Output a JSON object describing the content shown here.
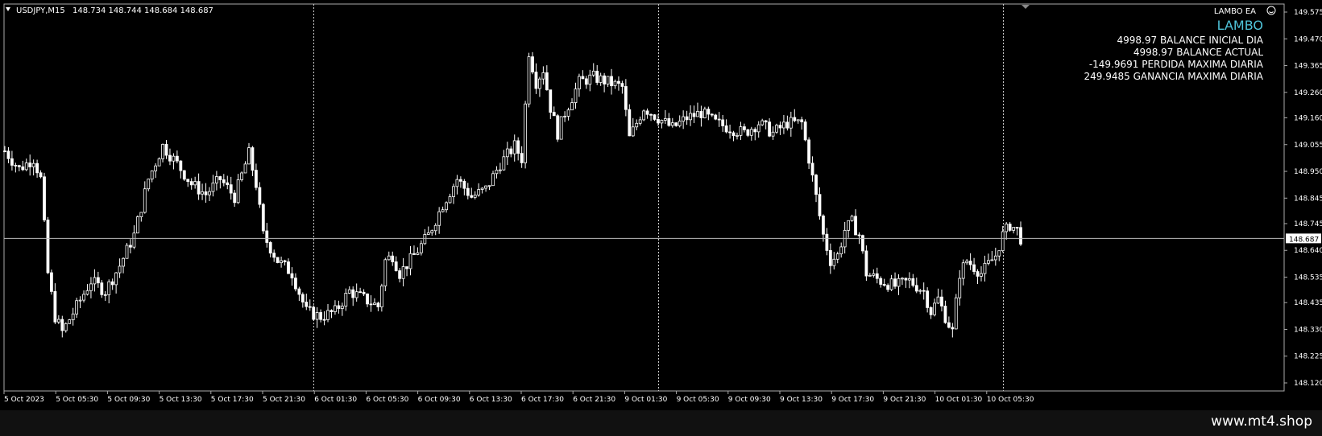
{
  "symbol_header": {
    "symbol": "USDJPY,M15",
    "ohlc": "148.734 148.744 148.684 148.687"
  },
  "ea": {
    "label": "LAMBO EA",
    "title": "LAMBO",
    "lines": [
      "4998.97 BALANCE INICIAL DIA",
      "4998.97 BALANCE ACTUAL",
      "-149.9691 PERDIDA MAXIMA DIARIA",
      "249.9485 GANANCIA MAXIMA DIARIA"
    ]
  },
  "footer": {
    "url": "www.mt4.shop"
  },
  "colors": {
    "background": "#000000",
    "candle": "#ffffff",
    "grid": "#cccccc",
    "ea_title": "#4fc3d9",
    "text": "#ffffff"
  },
  "chart_data": {
    "type": "candlestick",
    "ylim": [
      148.12,
      149.575
    ],
    "y_ticks": [
      "149.575",
      "149.470",
      "149.365",
      "149.260",
      "149.160",
      "149.055",
      "148.950",
      "148.845",
      "148.745",
      "148.640",
      "148.535",
      "148.435",
      "148.330",
      "148.225",
      "148.120"
    ],
    "x_ticks": [
      "5 Oct 2023",
      "5 Oct 05:30",
      "5 Oct 09:30",
      "5 Oct 13:30",
      "5 Oct 17:30",
      "5 Oct 21:30",
      "6 Oct 01:30",
      "6 Oct 05:30",
      "6 Oct 09:30",
      "6 Oct 13:30",
      "6 Oct 17:30",
      "6 Oct 21:30",
      "9 Oct 01:30",
      "9 Oct 05:30",
      "9 Oct 09:30",
      "9 Oct 13:30",
      "9 Oct 17:30",
      "9 Oct 21:30",
      "10 Oct 01:30",
      "10 Oct 05:30"
    ],
    "current_price": "148.687",
    "session_separators": [
      86,
      182,
      278,
      374
    ],
    "close_path": [
      [
        0,
        149.03
      ],
      [
        4,
        148.96
      ],
      [
        8,
        149.0
      ],
      [
        10,
        148.92
      ],
      [
        12,
        148.55
      ],
      [
        14,
        148.38
      ],
      [
        16,
        148.32
      ],
      [
        20,
        148.42
      ],
      [
        24,
        148.52
      ],
      [
        28,
        148.48
      ],
      [
        32,
        148.58
      ],
      [
        36,
        148.7
      ],
      [
        40,
        148.92
      ],
      [
        44,
        149.05
      ],
      [
        48,
        148.98
      ],
      [
        52,
        148.9
      ],
      [
        56,
        148.86
      ],
      [
        60,
        148.92
      ],
      [
        64,
        148.85
      ],
      [
        68,
        149.02
      ],
      [
        70,
        148.9
      ],
      [
        72,
        148.7
      ],
      [
        76,
        148.6
      ],
      [
        80,
        148.55
      ],
      [
        84,
        148.4
      ],
      [
        88,
        148.38
      ],
      [
        92,
        148.4
      ],
      [
        96,
        148.48
      ],
      [
        100,
        148.45
      ],
      [
        104,
        148.42
      ],
      [
        106,
        148.6
      ],
      [
        108,
        148.62
      ],
      [
        110,
        148.55
      ],
      [
        114,
        148.62
      ],
      [
        118,
        148.7
      ],
      [
        122,
        148.82
      ],
      [
        126,
        148.92
      ],
      [
        130,
        148.85
      ],
      [
        134,
        148.88
      ],
      [
        138,
        148.98
      ],
      [
        142,
        149.05
      ],
      [
        144,
        149.0
      ],
      [
        146,
        149.42
      ],
      [
        148,
        149.3
      ],
      [
        150,
        149.35
      ],
      [
        152,
        149.2
      ],
      [
        154,
        149.1
      ],
      [
        156,
        149.18
      ],
      [
        160,
        149.3
      ],
      [
        164,
        149.32
      ],
      [
        168,
        149.3
      ],
      [
        172,
        149.28
      ],
      [
        174,
        149.08
      ],
      [
        178,
        149.2
      ],
      [
        182,
        149.16
      ],
      [
        186,
        149.12
      ],
      [
        190,
        149.16
      ],
      [
        194,
        149.18
      ],
      [
        198,
        149.14
      ],
      [
        202,
        149.12
      ],
      [
        206,
        149.1
      ],
      [
        210,
        149.14
      ],
      [
        214,
        149.1
      ],
      [
        218,
        149.14
      ],
      [
        222,
        149.14
      ],
      [
        224,
        149.0
      ],
      [
        226,
        148.85
      ],
      [
        228,
        148.7
      ],
      [
        230,
        148.6
      ],
      [
        232,
        148.62
      ],
      [
        234,
        148.72
      ],
      [
        236,
        148.75
      ],
      [
        238,
        148.7
      ],
      [
        240,
        148.55
      ],
      [
        244,
        148.52
      ],
      [
        248,
        148.5
      ],
      [
        252,
        148.52
      ],
      [
        256,
        148.48
      ],
      [
        258,
        148.4
      ],
      [
        260,
        148.45
      ],
      [
        262,
        148.38
      ],
      [
        264,
        148.32
      ],
      [
        266,
        148.55
      ],
      [
        268,
        148.6
      ],
      [
        272,
        148.55
      ],
      [
        276,
        148.62
      ],
      [
        278,
        148.7
      ],
      [
        280,
        148.74
      ],
      [
        282,
        148.72
      ],
      [
        283,
        148.687
      ]
    ]
  }
}
